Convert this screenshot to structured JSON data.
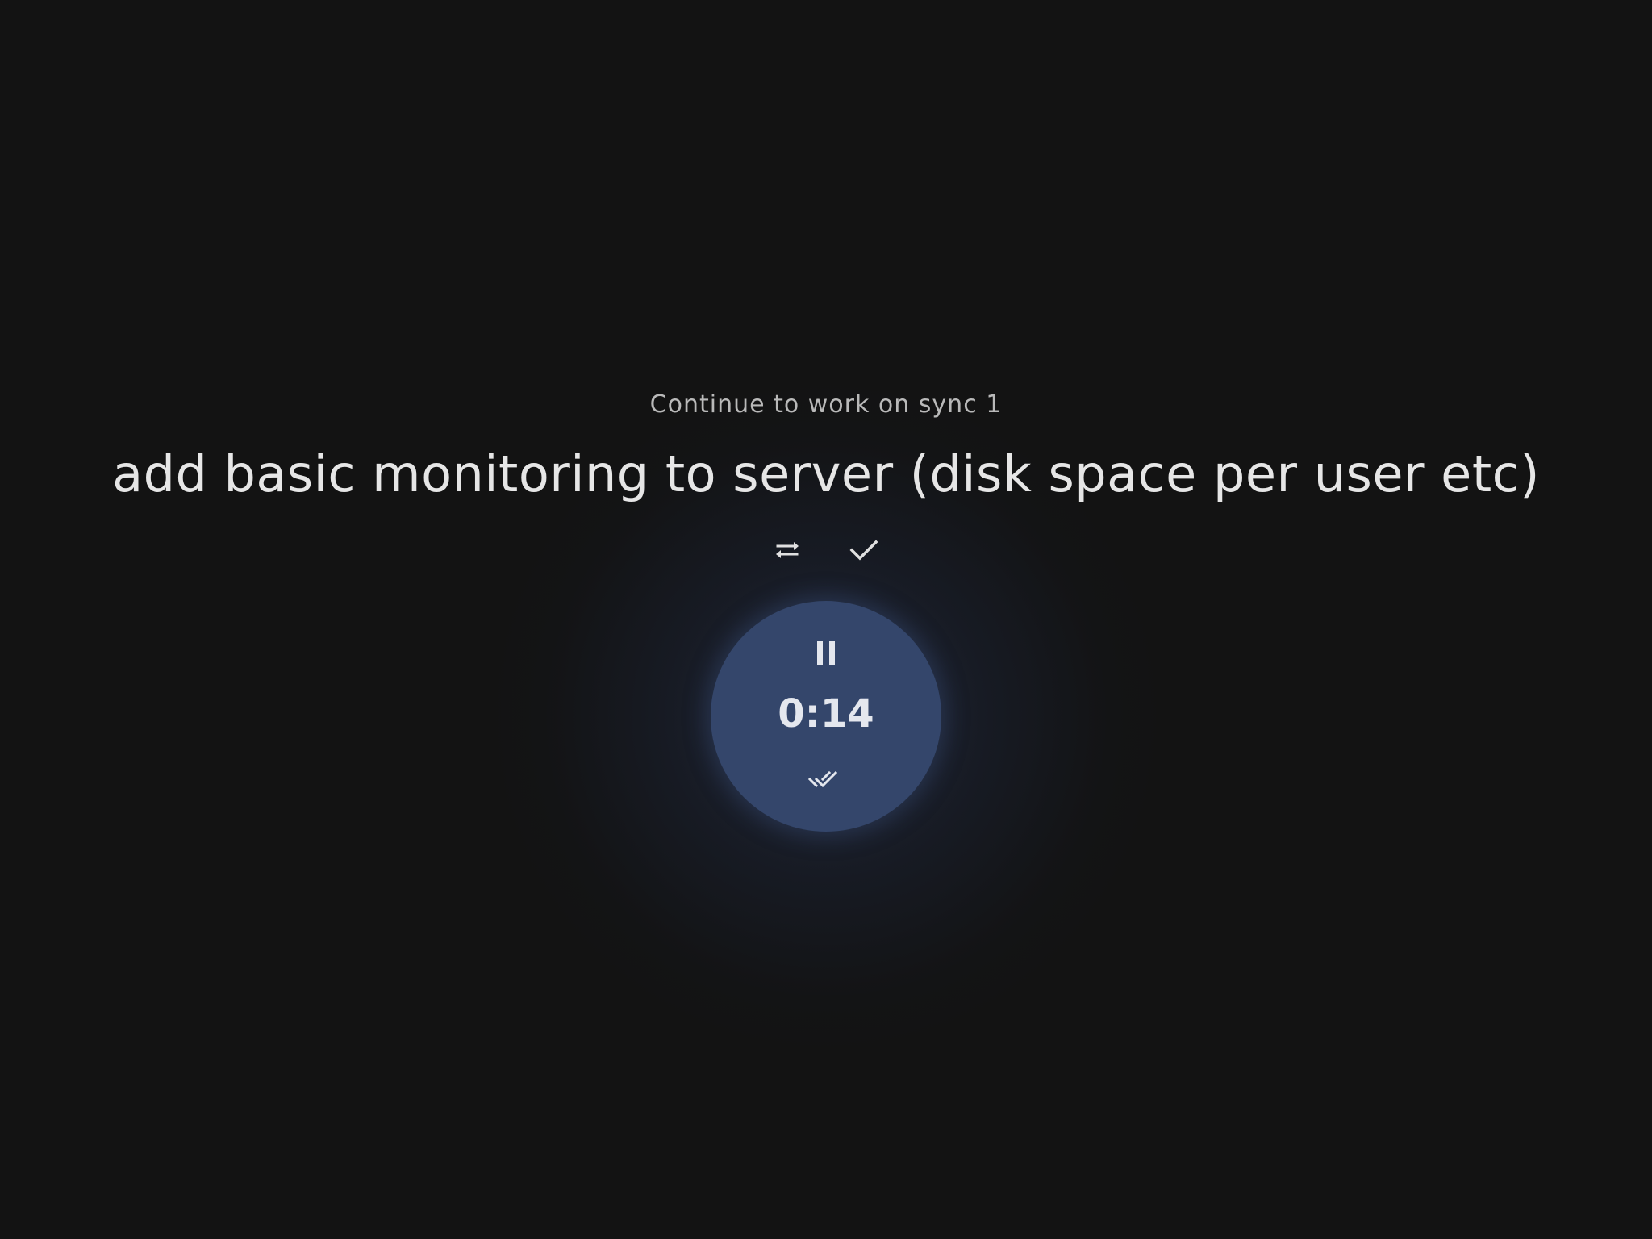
{
  "task": {
    "context": "Continue to work on sync 1",
    "title": "add basic monitoring to server (disk space per user etc)"
  },
  "actions": {
    "swap_icon": "swap-arrows-icon",
    "done_icon": "checkmark-icon"
  },
  "timer": {
    "time": "0:14",
    "state_icon": "pause-icon",
    "complete_icon": "double-check-icon"
  },
  "colors": {
    "background": "#131313",
    "timer_fill": "#34466b",
    "text_primary": "#e6e6e6",
    "text_secondary": "#b9b9b9"
  }
}
